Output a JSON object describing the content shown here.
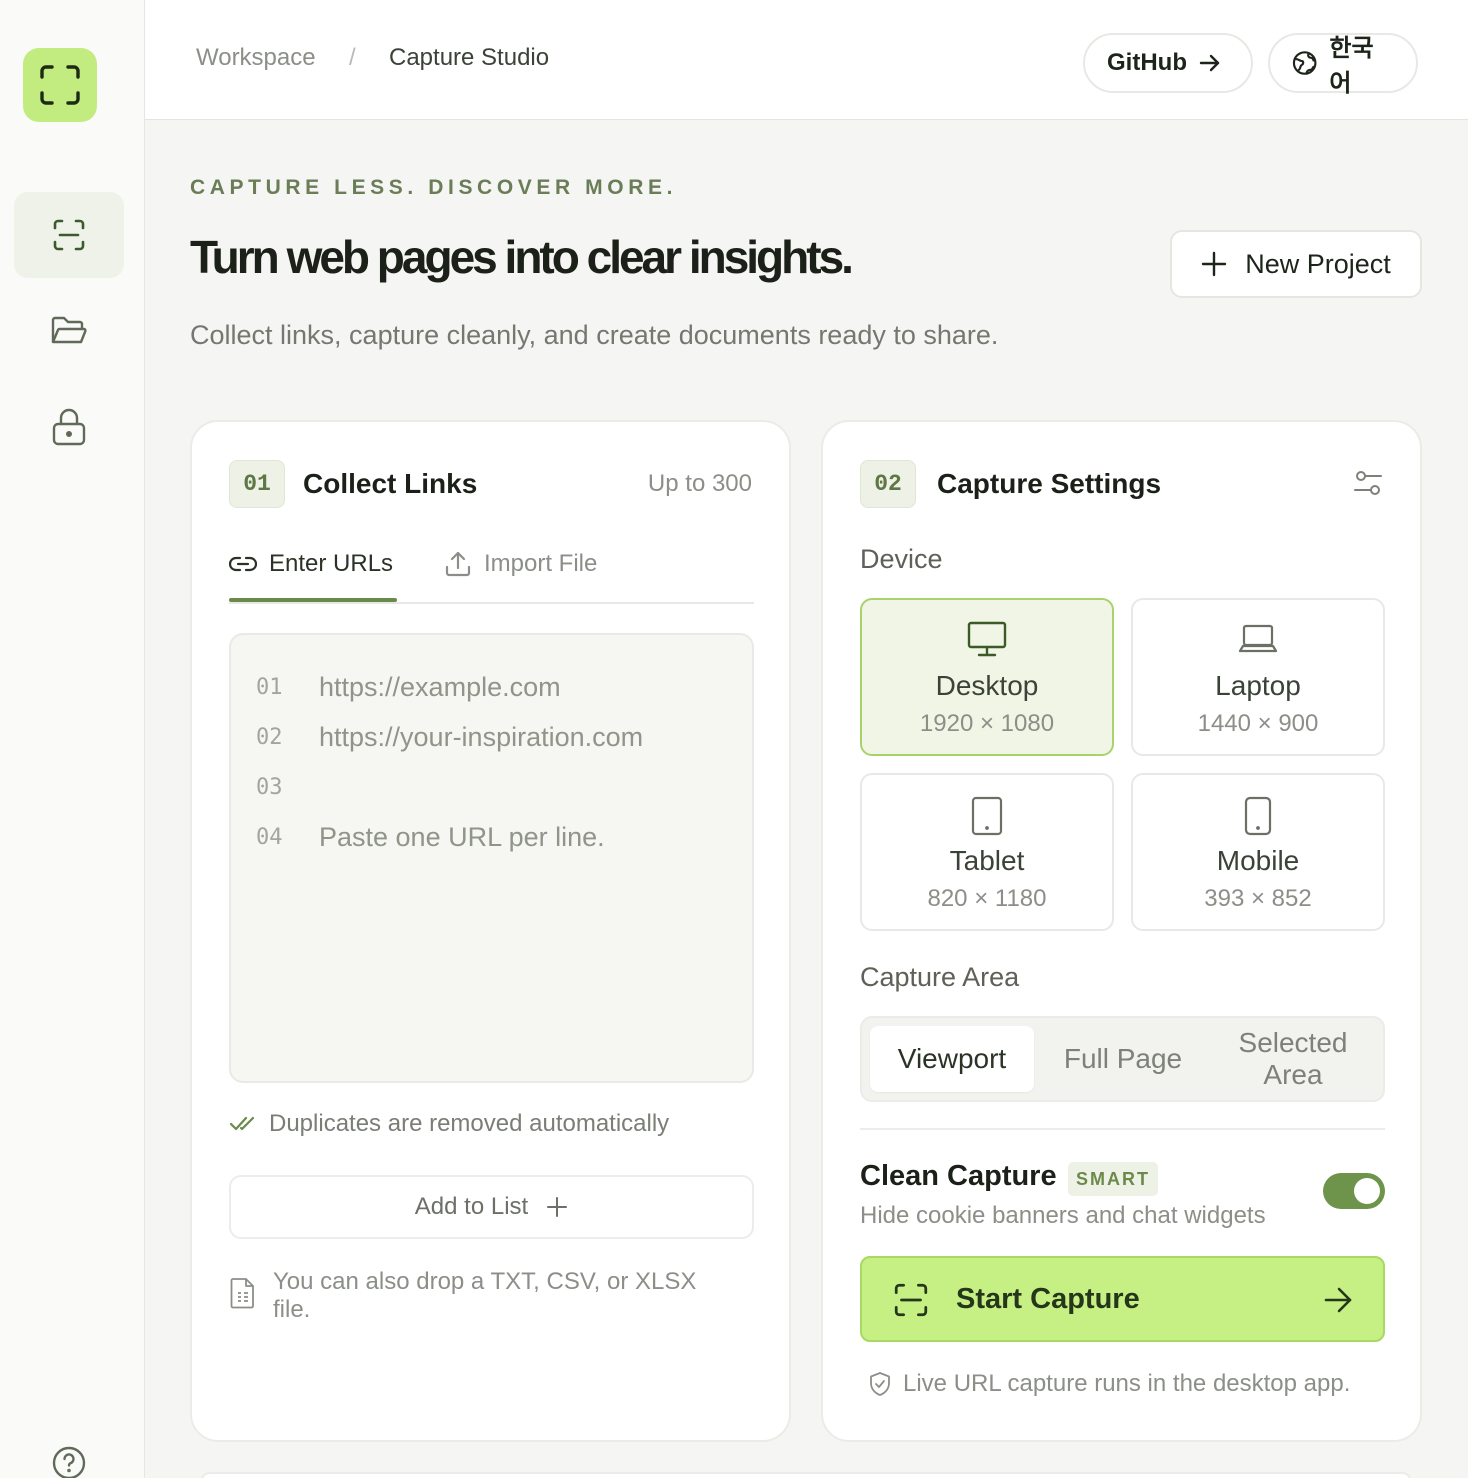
{
  "sidebar": {
    "logo_icon": "scan-frame-icon",
    "items": [
      {
        "icon": "scan-icon",
        "active": true
      },
      {
        "icon": "folder-open-icon",
        "active": false
      },
      {
        "icon": "lock-icon",
        "active": false
      }
    ],
    "help_icon": "help-icon"
  },
  "header": {
    "breadcrumb": [
      "Workspace",
      "Capture Studio"
    ],
    "separator": "/",
    "github_label": "GitHub",
    "language_label": "한국어"
  },
  "hero": {
    "tagline": "CAPTURE LESS. DISCOVER MORE.",
    "headline": "Turn web pages into clear insights.",
    "subline": "Collect links, capture cleanly, and create documents ready to share.",
    "new_project_label": "New Project"
  },
  "collect": {
    "step": "01",
    "title": "Collect Links",
    "note": "Up to 300",
    "tabs": {
      "enter": "Enter URLs",
      "import": "Import File"
    },
    "lines": [
      {
        "num": "01",
        "text": "https://example.com"
      },
      {
        "num": "02",
        "text": "https://your-inspiration.com"
      },
      {
        "num": "03",
        "text": ""
      },
      {
        "num": "04",
        "text": "Paste one URL per line."
      }
    ],
    "dup_note": "Duplicates are removed automatically",
    "add_label": "Add to List",
    "drop_note": "You can also drop a TXT, CSV, or XLSX file."
  },
  "settings": {
    "step": "02",
    "title": "Capture Settings",
    "device_label": "Device",
    "devices": [
      {
        "name": "Desktop",
        "res": "1920 × 1080",
        "active": true
      },
      {
        "name": "Laptop",
        "res": "1440 × 900",
        "active": false
      },
      {
        "name": "Tablet",
        "res": "820 × 1180",
        "active": false
      },
      {
        "name": "Mobile",
        "res": "393 × 852",
        "active": false
      }
    ],
    "area_label": "Capture Area",
    "areas": [
      "Viewport",
      "Full Page",
      "Selected Area"
    ],
    "selected_area": "Viewport",
    "clean_title": "Clean Capture",
    "smart_badge": "SMART",
    "clean_sub": "Hide cookie banners and chat widgets",
    "clean_enabled": true,
    "start_label": "Start Capture",
    "live_note": "Live URL capture runs in the desktop app."
  },
  "colors": {
    "accent": "#c2ec7f",
    "accent_dark": "#6e944c",
    "text": "#1b2118",
    "muted": "#8b8f88"
  }
}
